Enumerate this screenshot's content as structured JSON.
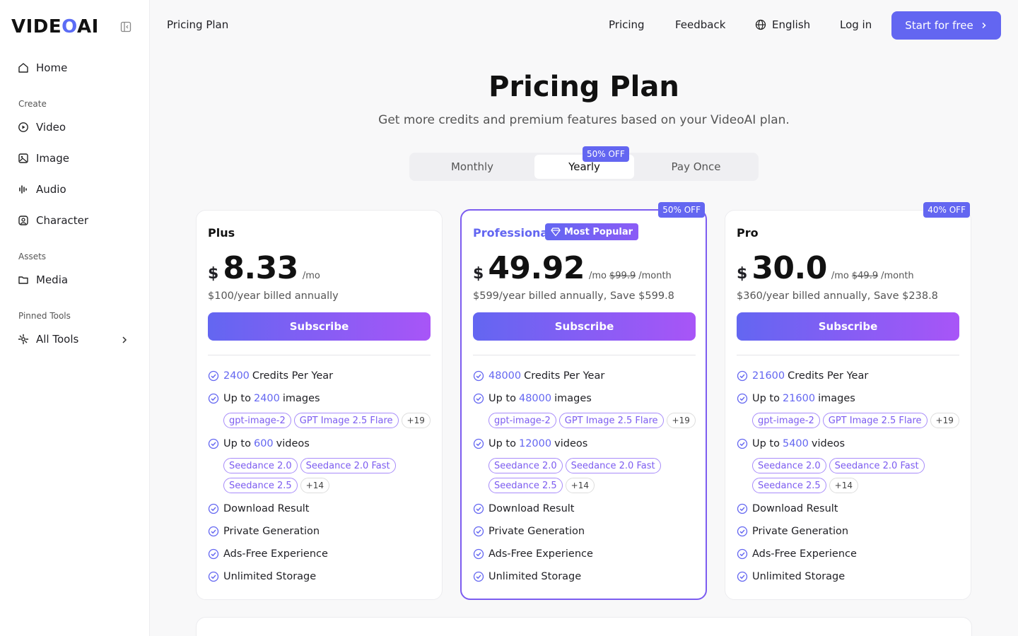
{
  "brand": {
    "logo_pre": "VIDE",
    "logo_o": "O",
    "logo_post": "AI",
    "accent": "#6366f1"
  },
  "sidebar": {
    "home": "Home",
    "section_create": "Create",
    "video": "Video",
    "image": "Image",
    "audio": "Audio",
    "character": "Character",
    "section_assets": "Assets",
    "media": "Media",
    "section_pinned": "Pinned Tools",
    "all_tools": "All Tools"
  },
  "topbar": {
    "page_title": "Pricing Plan",
    "pricing": "Pricing",
    "feedback": "Feedback",
    "language": "English",
    "login": "Log in",
    "start": "Start for free"
  },
  "hero": {
    "title": "Pricing Plan",
    "subtitle": "Get more credits and premium features based on your VideoAI plan."
  },
  "billing_toggle": {
    "monthly": "Monthly",
    "yearly": "Yearly",
    "pay_once": "Pay Once",
    "yearly_badge": "50% OFF",
    "selected": "Yearly"
  },
  "plans": [
    {
      "name": "Plus",
      "currency": "$",
      "price": "8.33",
      "per": "/mo",
      "old_price": "",
      "per_month": "",
      "billed": "$100/year billed annually",
      "subscribe": "Subscribe",
      "credits": "2400",
      "credits_label": "Credits Per Year",
      "images_pre": "Up to",
      "images": "2400",
      "images_label": "images",
      "image_models": [
        "gpt-image-2",
        "GPT Image 2.5 Flare"
      ],
      "image_more": "+19",
      "videos_pre": "Up to",
      "videos": "600",
      "videos_label": "videos",
      "video_models_row1": [
        "Seedance 2.0",
        "Seedance 2.0 Fast"
      ],
      "video_models_row2": [
        "Seedance 2.5"
      ],
      "video_more": "+14",
      "extras": [
        "Download Result",
        "Private Generation",
        "Ads-Free Experience",
        "Unlimited Storage"
      ]
    },
    {
      "name": "Professional",
      "badge": "Most Popular",
      "corner": "50% OFF",
      "currency": "$",
      "price": "49.92",
      "per": "/mo",
      "old_price": "$99.9",
      "per_month": "/month",
      "billed": "$599/year billed annually, Save $599.8",
      "subscribe": "Subscribe",
      "credits": "48000",
      "credits_label": "Credits Per Year",
      "images_pre": "Up to",
      "images": "48000",
      "images_label": "images",
      "image_models": [
        "gpt-image-2",
        "GPT Image 2.5 Flare"
      ],
      "image_more": "+19",
      "videos_pre": "Up to",
      "videos": "12000",
      "videos_label": "videos",
      "video_models_row1": [
        "Seedance 2.0",
        "Seedance 2.0 Fast"
      ],
      "video_models_row2": [
        "Seedance 2.5"
      ],
      "video_more": "+14",
      "extras": [
        "Download Result",
        "Private Generation",
        "Ads-Free Experience",
        "Unlimited Storage"
      ]
    },
    {
      "name": "Pro",
      "corner": "40% OFF",
      "currency": "$",
      "price": "30.0",
      "per": "/mo",
      "old_price": "$49.9",
      "per_month": "/month",
      "billed": "$360/year billed annually, Save $238.8",
      "subscribe": "Subscribe",
      "credits": "21600",
      "credits_label": "Credits Per Year",
      "images_pre": "Up to",
      "images": "21600",
      "images_label": "images",
      "image_models": [
        "gpt-image-2",
        "GPT Image 2.5 Flare"
      ],
      "image_more": "+19",
      "videos_pre": "Up to",
      "videos": "5400",
      "videos_label": "videos",
      "video_models_row1": [
        "Seedance 2.0",
        "Seedance 2.0 Fast"
      ],
      "video_models_row2": [
        "Seedance 2.5"
      ],
      "video_more": "+14",
      "extras": [
        "Download Result",
        "Private Generation",
        "Ads-Free Experience",
        "Unlimited Storage"
      ]
    }
  ]
}
